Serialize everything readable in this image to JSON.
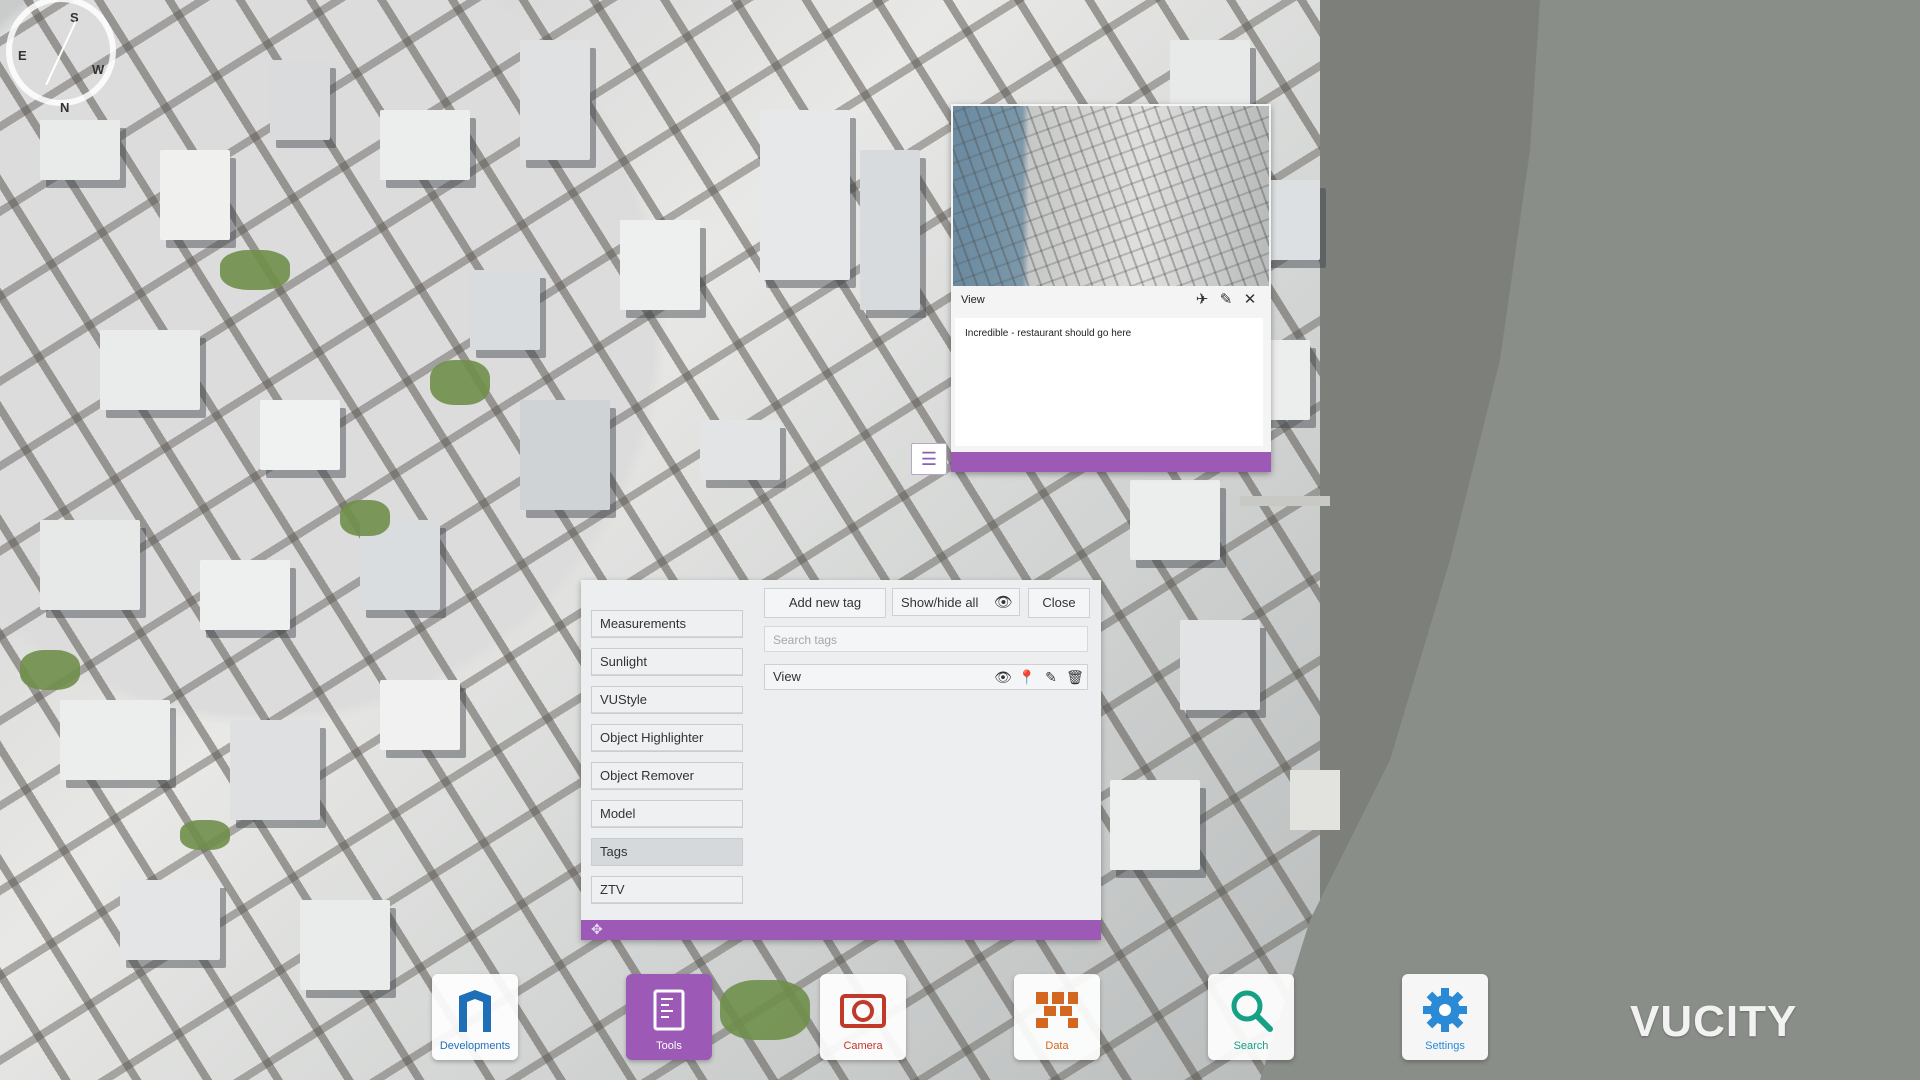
{
  "compass": {
    "n": "N",
    "s": "S",
    "e": "E",
    "w": "W"
  },
  "tag_popup": {
    "title": "View",
    "note": "Incredible - restaurant should go here",
    "icons": [
      "pin-icon",
      "edit-icon",
      "close-icon"
    ]
  },
  "tools_panel": {
    "menu": [
      {
        "label": "Measurements"
      },
      {
        "label": "Sunlight"
      },
      {
        "label": "VUStyle"
      },
      {
        "label": "Object Highlighter"
      },
      {
        "label": "Object Remover"
      },
      {
        "label": "Model"
      },
      {
        "label": "Tags",
        "active": true
      },
      {
        "label": "ZTV"
      }
    ],
    "add_new_tag": "Add new tag",
    "show_hide_all": "Show/hide all",
    "close": "Close",
    "search_placeholder": "Search tags",
    "tags": [
      {
        "name": "View",
        "icons": [
          "eye-icon",
          "location-icon",
          "edit-icon",
          "trash-icon"
        ]
      }
    ]
  },
  "dock": [
    {
      "label": "Developments",
      "color": "#1e6fb8",
      "icon": "developments-icon"
    },
    {
      "label": "Tools",
      "color": "#ffffff",
      "icon": "tools-icon",
      "active": true
    },
    {
      "label": "Camera",
      "color": "#c0392b",
      "icon": "camera-icon"
    },
    {
      "label": "Data",
      "color": "#d4671f",
      "icon": "data-icon"
    },
    {
      "label": "Search",
      "color": "#16a085",
      "icon": "search-icon"
    },
    {
      "label": "Settings",
      "color": "#2a8ad6",
      "icon": "settings-icon"
    }
  ],
  "brand": {
    "logo": "VUCITY",
    "accent": "#9c59b6"
  }
}
